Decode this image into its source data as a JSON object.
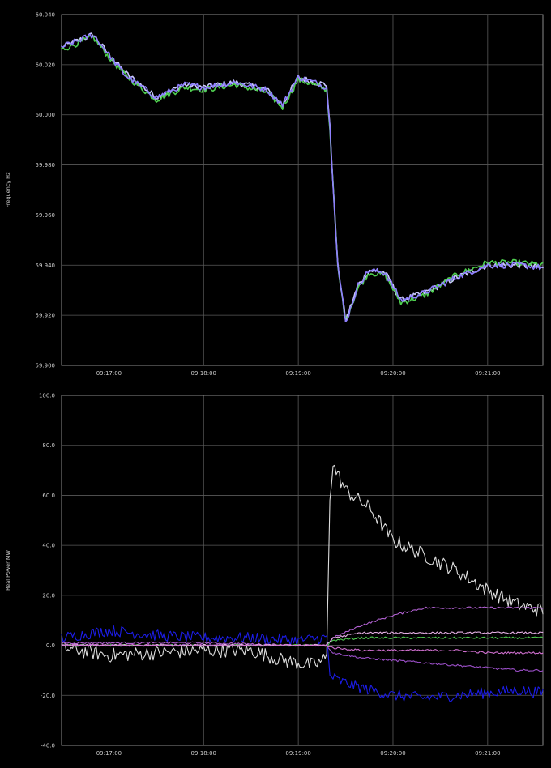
{
  "chart_data": [
    {
      "type": "line",
      "ylabel": "Frequency Hz",
      "xlabel": "",
      "ylim": [
        59.9,
        60.04
      ],
      "xlim": [
        "09:16:30",
        "09:21:35"
      ],
      "yticks": [
        "60.040",
        "60.020",
        "60.000",
        "59.980",
        "59.960",
        "59.940",
        "59.920",
        "59.900"
      ],
      "ytick_values": [
        60.04,
        60.02,
        60.0,
        59.98,
        59.96,
        59.94,
        59.92,
        59.9
      ],
      "xticks": [
        "09:17:00",
        "09:18:00",
        "09:19:00",
        "09:20:00",
        "09:21:00"
      ],
      "grid": true,
      "series": [
        {
          "color": "#c9c9ff",
          "x": [
            "09:16:30",
            "09:16:50",
            "09:17:00",
            "09:17:10",
            "09:17:30",
            "09:17:48",
            "09:18:00",
            "09:18:20",
            "09:18:40",
            "09:18:50",
            "09:19:00",
            "09:19:10",
            "09:19:18",
            "09:19:20",
            "09:19:25",
            "09:19:30",
            "09:19:38",
            "09:19:45",
            "09:19:55",
            "09:20:05",
            "09:20:20",
            "09:20:40",
            "09:21:00",
            "09:21:20",
            "09:21:35"
          ],
          "y": [
            60.027,
            60.032,
            60.024,
            60.017,
            60.007,
            60.012,
            60.011,
            60.013,
            60.01,
            60.004,
            60.015,
            60.013,
            60.012,
            59.995,
            59.94,
            59.918,
            59.932,
            59.938,
            59.937,
            59.926,
            59.929,
            59.935,
            59.94,
            59.94,
            59.939
          ]
        },
        {
          "color": "#4fd04f",
          "x": [
            "09:16:30",
            "09:16:50",
            "09:17:00",
            "09:17:10",
            "09:17:30",
            "09:17:48",
            "09:18:00",
            "09:18:20",
            "09:18:40",
            "09:18:50",
            "09:19:00",
            "09:19:10",
            "09:19:18",
            "09:19:20",
            "09:19:25",
            "09:19:30",
            "09:19:38",
            "09:19:45",
            "09:19:55",
            "09:20:05",
            "09:20:20",
            "09:20:40",
            "09:21:00",
            "09:21:20",
            "09:21:35"
          ],
          "y": [
            60.026,
            60.031,
            60.023,
            60.016,
            60.006,
            60.011,
            60.01,
            60.012,
            60.009,
            60.003,
            60.014,
            60.012,
            60.01,
            59.994,
            59.939,
            59.918,
            59.931,
            59.937,
            59.936,
            59.925,
            59.928,
            59.936,
            59.941,
            59.941,
            59.94
          ]
        },
        {
          "color": "#8f7fff",
          "x": [
            "09:16:30",
            "09:16:50",
            "09:17:00",
            "09:17:10",
            "09:17:30",
            "09:17:48",
            "09:18:00",
            "09:18:20",
            "09:18:40",
            "09:18:50",
            "09:19:00",
            "09:19:10",
            "09:19:18",
            "09:19:20",
            "09:19:25",
            "09:19:30",
            "09:19:38",
            "09:19:45",
            "09:19:55",
            "09:20:05",
            "09:20:20",
            "09:20:40",
            "09:21:00",
            "09:21:20",
            "09:21:35"
          ],
          "y": [
            60.027,
            60.032,
            60.024,
            60.016,
            60.007,
            60.012,
            60.011,
            60.013,
            60.01,
            60.004,
            60.015,
            60.013,
            60.011,
            59.995,
            59.94,
            59.917,
            59.932,
            59.938,
            59.937,
            59.926,
            59.929,
            59.935,
            59.94,
            59.94,
            59.939
          ]
        }
      ]
    },
    {
      "type": "line",
      "ylabel": "Real Power MW",
      "xlabel": "",
      "ylim": [
        -40,
        100
      ],
      "xlim": [
        "09:16:30",
        "09:21:35"
      ],
      "yticks": [
        "100.0",
        "80.0",
        "60.0",
        "40.0",
        "20.0",
        "0.0",
        "-20.0",
        "-40.0"
      ],
      "ytick_values": [
        100,
        80,
        60,
        40,
        20,
        0,
        -20,
        -40
      ],
      "xticks": [
        "09:17:00",
        "09:18:00",
        "09:19:00",
        "09:20:00",
        "09:21:00"
      ],
      "grid": true,
      "series": [
        {
          "color": "#dcdcdc",
          "x": [
            "09:16:30",
            "09:17:00",
            "09:17:30",
            "09:18:00",
            "09:18:30",
            "09:18:50",
            "09:19:10",
            "09:19:18",
            "09:19:20",
            "09:19:22",
            "09:19:30",
            "09:19:45",
            "09:20:00",
            "09:20:20",
            "09:20:40",
            "09:21:00",
            "09:21:20",
            "09:21:35"
          ],
          "y": [
            -1,
            -4,
            -3,
            -2,
            -2,
            -6,
            -8,
            -5,
            60,
            72,
            62,
            55,
            42,
            36,
            30,
            22,
            16,
            14
          ]
        },
        {
          "color": "#1c1ce6",
          "x": [
            "09:16:30",
            "09:17:00",
            "09:17:30",
            "09:18:00",
            "09:18:30",
            "09:19:00",
            "09:19:18",
            "09:19:20",
            "09:19:25",
            "09:19:40",
            "09:20:00",
            "09:20:20",
            "09:20:40",
            "09:21:00",
            "09:21:20",
            "09:21:35"
          ],
          "y": [
            3,
            6,
            4,
            3,
            3,
            2,
            3,
            -12,
            -14,
            -17,
            -20,
            -21,
            -20,
            -19,
            -18,
            -19
          ]
        },
        {
          "color": "#b060d0",
          "x": [
            "09:16:30",
            "09:17:00",
            "09:18:00",
            "09:19:00",
            "09:19:18",
            "09:19:22",
            "09:19:40",
            "09:20:00",
            "09:20:20",
            "09:20:40",
            "09:21:00",
            "09:21:20",
            "09:21:35"
          ],
          "y": [
            1,
            1,
            1,
            0,
            0,
            3,
            8,
            12,
            15,
            15,
            15,
            15,
            15
          ]
        },
        {
          "color": "#9b4fc8",
          "x": [
            "09:16:30",
            "09:17:00",
            "09:18:00",
            "09:19:00",
            "09:19:18",
            "09:19:22",
            "09:19:40",
            "09:20:00",
            "09:20:20",
            "09:20:40",
            "09:21:00",
            "09:21:20",
            "09:21:35"
          ],
          "y": [
            0,
            0,
            0,
            0,
            0,
            -3,
            -5,
            -6,
            -7,
            -8,
            -9,
            -10,
            -10
          ]
        },
        {
          "color": "#4fc84f",
          "x": [
            "09:16:30",
            "09:17:00",
            "09:18:00",
            "09:19:00",
            "09:19:18",
            "09:19:22",
            "09:19:40",
            "09:20:00",
            "09:20:20",
            "09:20:40",
            "09:21:00",
            "09:21:20",
            "09:21:35"
          ],
          "y": [
            0,
            0,
            0,
            0,
            0,
            2,
            3,
            3,
            3,
            3,
            3,
            3,
            3
          ]
        },
        {
          "color": "#e6b0e6",
          "x": [
            "09:16:30",
            "09:17:00",
            "09:18:00",
            "09:19:00",
            "09:19:18",
            "09:19:22",
            "09:19:40",
            "09:20:00",
            "09:20:20",
            "09:20:40",
            "09:21:00",
            "09:21:20",
            "09:21:35"
          ],
          "y": [
            0,
            0,
            0,
            0,
            0,
            3,
            5,
            5,
            5,
            5,
            5,
            5,
            5
          ]
        },
        {
          "color": "#d070d0",
          "x": [
            "09:16:30",
            "09:17:00",
            "09:18:00",
            "09:19:00",
            "09:19:18",
            "09:19:22",
            "09:19:40",
            "09:20:00",
            "09:20:20",
            "09:20:40",
            "09:21:00",
            "09:21:20",
            "09:21:35"
          ],
          "y": [
            0,
            0,
            0,
            0,
            0,
            -1,
            -2,
            -2,
            -2,
            -2,
            -3,
            -3,
            -3
          ]
        }
      ]
    }
  ]
}
